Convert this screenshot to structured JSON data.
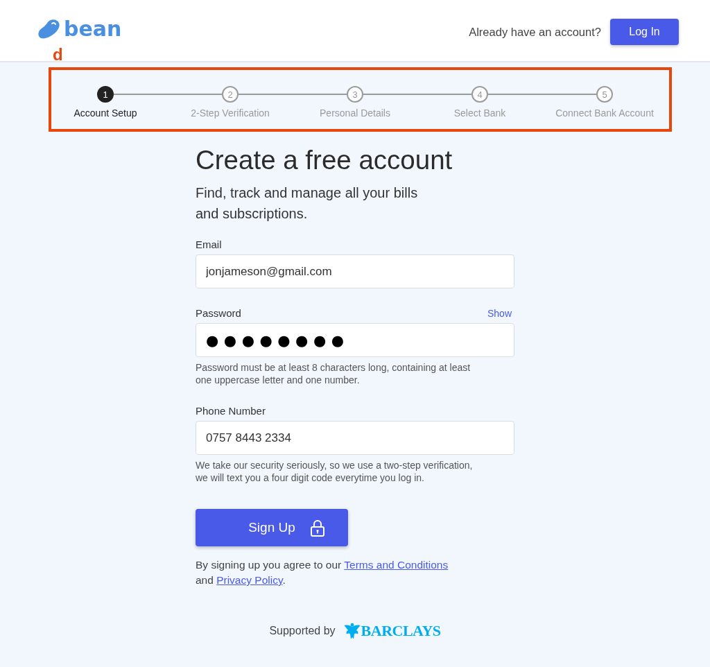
{
  "header": {
    "logo": "bean",
    "prompt": "Already have an account?",
    "login_button": "Log In"
  },
  "annotation": {
    "label": "d"
  },
  "steps": [
    {
      "number": "1",
      "label": "Account Setup",
      "selected": true
    },
    {
      "number": "2",
      "label": "2-Step Verification",
      "selected": false
    },
    {
      "number": "3",
      "label": "Personal Details",
      "selected": false
    },
    {
      "number": "4",
      "label": "Select Bank",
      "selected": false
    },
    {
      "number": "5",
      "label": "Connect Bank Account",
      "selected": false
    }
  ],
  "form": {
    "title": "Create a free account",
    "subtitle": "Find, track and manage all your bills and subscriptions.",
    "fields": [
      {
        "kind": "text",
        "label": "Email",
        "value": "jonjameson@gmail.com"
      },
      {
        "kind": "password",
        "label": "Password",
        "action": "Show",
        "value": "●●●●●●●●",
        "hint": "Password must be at least 8 characters long, containing at least one uppercase letter and one number."
      },
      {
        "kind": "text",
        "label": "Phone Number",
        "value": "0757 8443 2334",
        "hint": "We take our security seriously, so we use a two-step verification, we will text you a four digit code everytime you log in."
      }
    ],
    "submit_button": "Sign Up",
    "agreement": [
      {
        "kind": "text",
        "text": "By signing up you agree to our "
      },
      {
        "kind": "link",
        "text": "Terms and Conditions"
      },
      {
        "kind": "text",
        "text": " and "
      },
      {
        "kind": "link",
        "text": "Privacy Policy"
      },
      {
        "kind": "text",
        "text": "."
      }
    ]
  },
  "footer": {
    "supported_by": "Supported by",
    "sponsor": "BARCLAYS"
  }
}
